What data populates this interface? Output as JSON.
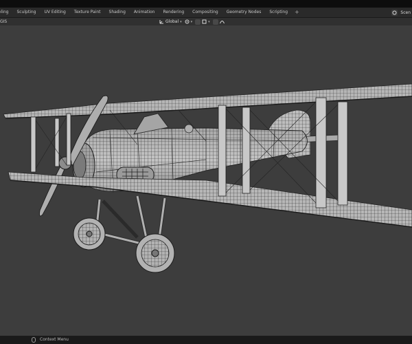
{
  "workspace_tabs": [
    "deling",
    "Sculpting",
    "UV Editing",
    "Texture Paint",
    "Shading",
    "Animation",
    "Rendering",
    "Compositing",
    "Geometry Nodes",
    "Scripting"
  ],
  "add_tab": "+",
  "scene_label": "Scen",
  "header": {
    "left_label": "GIS",
    "transform_orientation": "Global"
  },
  "statusbar": {
    "context_menu": "Context Menu"
  },
  "icons": [
    "transform-orientation-icon",
    "pivot-icon",
    "snap-icon",
    "proportional-edit-icon",
    "scene-icon",
    "mouse-icon"
  ],
  "colors": {
    "viewport_bg": "#3d3d3d",
    "wire": "#1c1c1c",
    "surface": "#b9b9b9",
    "topbar": "#0d0d0d"
  }
}
